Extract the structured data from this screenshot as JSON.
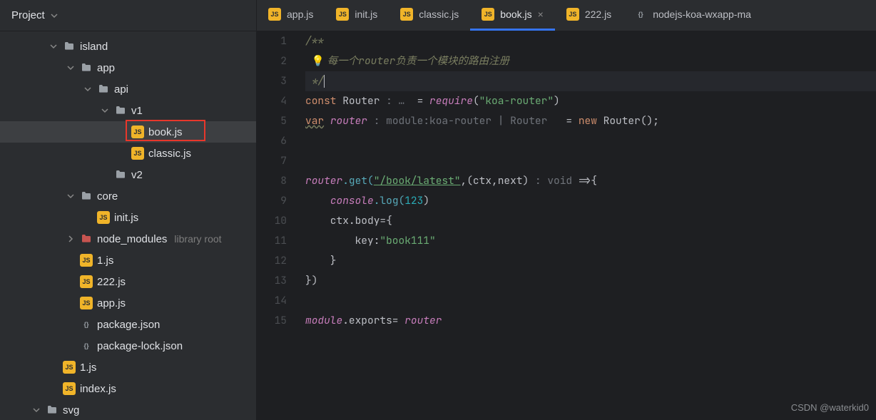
{
  "sidebar": {
    "title": "Project",
    "tree": {
      "island": "island",
      "app": "app",
      "api": "api",
      "v1": "v1",
      "bookjs": "book.js",
      "classicjs": "classic.js",
      "v2": "v2",
      "core": "core",
      "initjs": "init.js",
      "node_modules": "node_modules",
      "node_modules_hint": "library root",
      "onejs": "1.js",
      "twotwotwo": "222.js",
      "appjs": "app.js",
      "packagejson": "package.json",
      "packagelockjson": "package-lock.json",
      "root_onejs": "1.js",
      "indexjs": "index.js",
      "svg": "svg"
    }
  },
  "tabs": [
    {
      "label": "app.js",
      "icon": "js"
    },
    {
      "label": "init.js",
      "icon": "js"
    },
    {
      "label": "classic.js",
      "icon": "js"
    },
    {
      "label": "book.js",
      "icon": "js",
      "active": true,
      "closeable": true
    },
    {
      "label": "222.js",
      "icon": "js"
    },
    {
      "label": "nodejs-koa-wxapp-ma",
      "icon": "json"
    }
  ],
  "code": {
    "lines": [
      "1",
      "2",
      "3",
      "4",
      "5",
      "6",
      "7",
      "8",
      "9",
      "10",
      "11",
      "12",
      "13",
      "14",
      "15"
    ],
    "l1": "/**",
    "l2_comment": "每一个router负责一个模块的路由注册",
    "l3": " */",
    "l4_const": "const",
    "l4_router": " Router ",
    "l4_hint": ": … ",
    "l4_eq": " = ",
    "l4_require": "require",
    "l4_open": "(",
    "l4_str": "\"koa-router\"",
    "l4_close": ")",
    "l5_var": "var",
    "l5_router": "router",
    "l5_hint": " : module:koa-router | Router  ",
    "l5_eq": " = ",
    "l5_new": "new",
    "l5_Router": " Router();",
    "l8_router": "router",
    "l8_get": ".get(",
    "l8_str": "\"/book/latest\"",
    "l8_mid": ",(ctx,next) ",
    "l8_hint": ": void ",
    "l8_arrow": "=>{",
    "l9_console": "console",
    "l9_log": ".log(",
    "l9_num": "123",
    "l9_close": ")",
    "l10": "    ctx.body={",
    "l11_key": "        key:",
    "l11_str": "\"book111\"",
    "l12": "    }",
    "l13": "})",
    "l15_module": "module",
    "l15_exports": ".exports= ",
    "l15_router": "router"
  },
  "watermark": "CSDN @waterkid0"
}
